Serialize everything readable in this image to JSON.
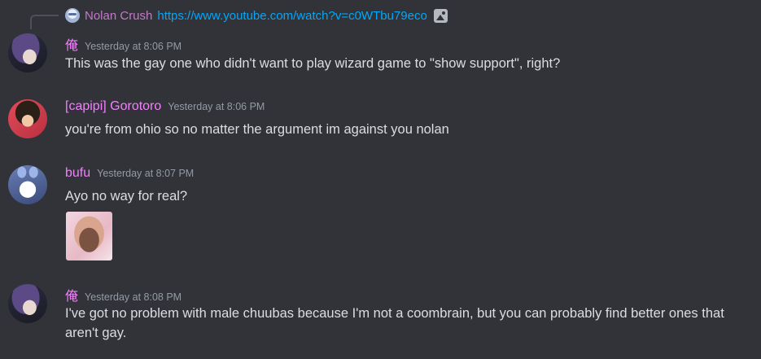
{
  "reply": {
    "author": "Nolan Crush",
    "link": "https://www.youtube.com/watch?v=c0WTbu79eco",
    "avatar_icon": "user-avatar",
    "attachment_icon": "image-icon"
  },
  "messages": [
    {
      "username": "俺",
      "username_color": "#f47fff",
      "timestamp": "Yesterday at 8:06 PM",
      "text": "This was the gay one who didn't want to play wizard game to \"show support\", right?"
    },
    {
      "username": "[capipi] Gorotoro",
      "username_color": "#f47fff",
      "timestamp": "Yesterday at 8:06 PM",
      "text": "you're from ohio so no matter the argument im against you nolan"
    },
    {
      "username": "bufu",
      "username_color": "#f47fff",
      "timestamp": "Yesterday at 8:07 PM",
      "text": "Ayo no way for real?",
      "attachment": "image"
    },
    {
      "username": "俺",
      "username_color": "#f47fff",
      "timestamp": "Yesterday at 8:08 PM",
      "text": "I've got no problem with male chuubas because I'm not a coombrain, but you can probably find better ones that aren't gay."
    }
  ],
  "colors": {
    "background": "#313338",
    "text": "#dbdee1",
    "timestamp": "#949ba4",
    "link": "#00a8fc",
    "reply_author": "#c479c8"
  }
}
